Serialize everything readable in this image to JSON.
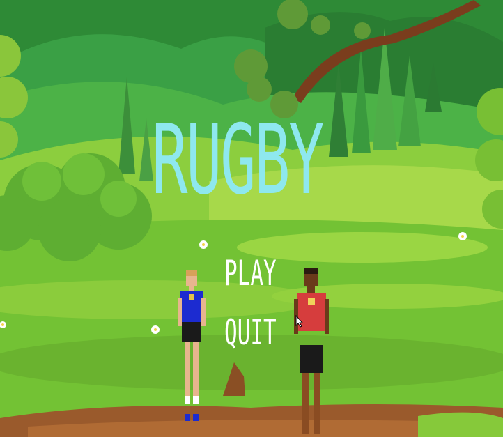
{
  "game": {
    "title": "RUGBY",
    "menu": {
      "play_label": "PLAY",
      "quit_label": "QUIT"
    }
  },
  "colors": {
    "title": "#8ee8ee",
    "menu_text": "#ffffff",
    "sky_hills": "#2f8a3a",
    "grass": "#7cc832",
    "dirt_path": "#9a5a2c",
    "player_blue_jersey": "#1c2bd0",
    "player_red_jersey": "#d63d3d"
  },
  "icons": {
    "cursor": "mouse-cursor-icon",
    "flowers": "daisy-flower-icon"
  }
}
